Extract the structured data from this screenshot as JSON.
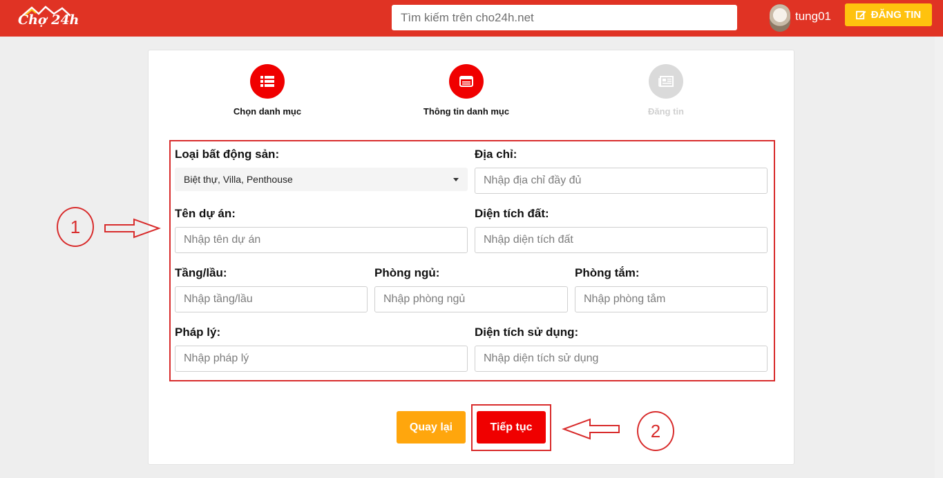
{
  "header": {
    "logo_text": "Chợ 24h",
    "search_placeholder": "Tìm kiếm trên cho24h.net",
    "username": "tung01",
    "post_button_label": "ĐĂNG TIN"
  },
  "steps": [
    {
      "label": "Chọn danh mục",
      "state": "active",
      "icon": "list-icon"
    },
    {
      "label": "Thông tin danh mục",
      "state": "active",
      "icon": "window-icon"
    },
    {
      "label": "Đăng tin",
      "state": "inactive",
      "icon": "newspaper-icon"
    }
  ],
  "form": {
    "property_type": {
      "label": "Loại bất động sản:",
      "value": "Biệt thự, Villa, Penthouse"
    },
    "address": {
      "label": "Địa chỉ:",
      "placeholder": "Nhập địa chỉ đầy đủ"
    },
    "project_name": {
      "label": "Tên dự án:",
      "placeholder": "Nhập tên dự án"
    },
    "land_area": {
      "label": "Diện tích đất:",
      "placeholder": "Nhập diện tích đất"
    },
    "floors": {
      "label": "Tầng/lầu:",
      "placeholder": "Nhập tầng/lầu"
    },
    "bedrooms": {
      "label": "Phòng ngủ:",
      "placeholder": "Nhập phòng ngủ"
    },
    "bathrooms": {
      "label": "Phòng tắm:",
      "placeholder": "Nhập phòng tắm"
    },
    "legal": {
      "label": "Pháp lý:",
      "placeholder": "Nhập pháp lý"
    },
    "usable_area": {
      "label": "Diện tích sử dụng:",
      "placeholder": "Nhập diện tích sử dụng"
    }
  },
  "actions": {
    "back_label": "Quay lại",
    "next_label": "Tiếp tục"
  },
  "annotations": {
    "marker_1": "1",
    "marker_2": "2"
  },
  "colors": {
    "header": "#e03324",
    "accent_red": "#f00000",
    "button_yellow": "#ffc20e",
    "button_orange": "#ffa60d",
    "annotation_red": "#d82b2b",
    "step_inactive": "#dadada"
  }
}
